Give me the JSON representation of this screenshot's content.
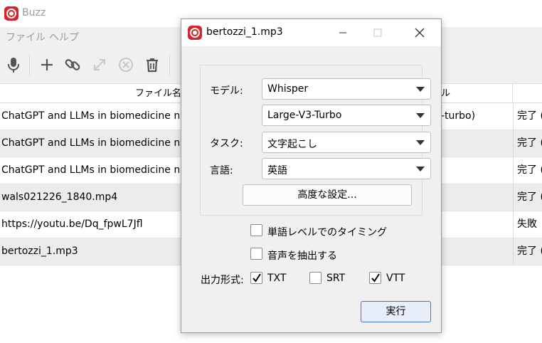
{
  "app": {
    "title": "Buzz"
  },
  "menu": [
    "ファイル",
    "ヘルプ"
  ],
  "toolbar_icons": [
    "microphone-icon",
    "plus-icon",
    "link-icon",
    "expand-icon",
    "cancel-circle-icon",
    "trash-icon"
  ],
  "table": {
    "headers": {
      "name": "ファイル名",
      "model": "ル"
    },
    "rows": [
      {
        "name": "ChatGPT and LLMs in biomedicine nlm",
        "model": "-turbo)",
        "status": "完了 ("
      },
      {
        "name": "ChatGPT and LLMs in biomedicine nlm",
        "model": "",
        "status": "完了 ("
      },
      {
        "name": "ChatGPT and LLMs in biomedicine nlm",
        "model": "",
        "status": "完了 ("
      },
      {
        "name": "wals021226_1840.mp4",
        "model": "",
        "status": "完了 ("
      },
      {
        "name": "https://youtu.be/Dq_fpwL7Jfl",
        "model": "",
        "status": "失敗"
      },
      {
        "name": "bertozzi_1.mp3",
        "model": "",
        "status": "完了 ("
      }
    ]
  },
  "dialog": {
    "title": "bertozzi_1.mp3",
    "model_label": "モデル:",
    "model_value": "Whisper",
    "model_size_value": "Large-V3-Turbo",
    "task_label": "タスク:",
    "task_value": "文字起こし",
    "language_label": "言語:",
    "language_value": "英語",
    "advanced_button": "高度な設定...",
    "word_timing_label": "単語レベルでのタイミング",
    "word_timing_checked": false,
    "extract_audio_label": "音声を抽出する",
    "extract_audio_checked": false,
    "output_format_label": "出力形式:",
    "formats": [
      {
        "label": "TXT",
        "checked": true
      },
      {
        "label": "SRT",
        "checked": false
      },
      {
        "label": "VTT",
        "checked": true
      }
    ],
    "run_button": "実行"
  }
}
